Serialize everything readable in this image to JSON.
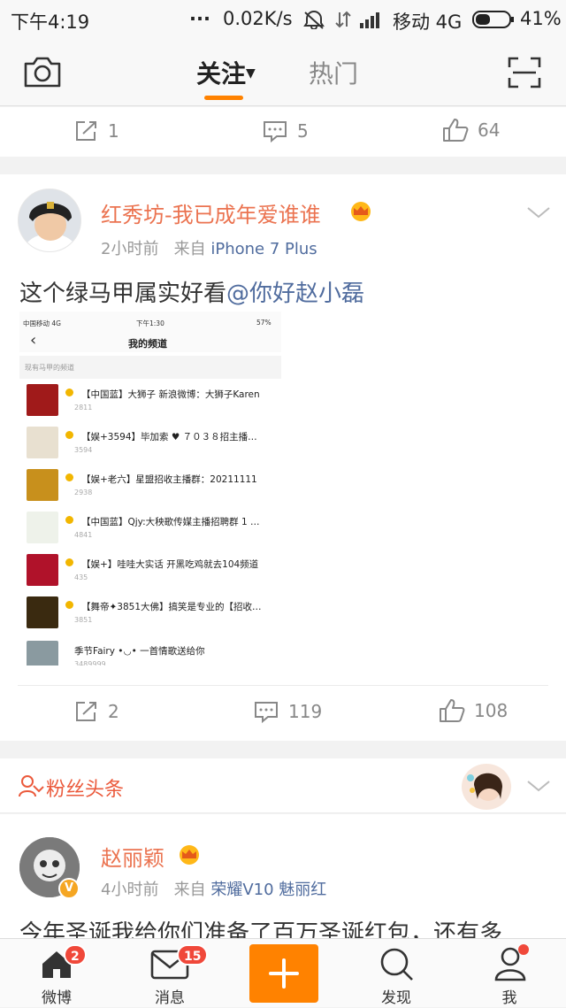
{
  "status_bar": {
    "time": "下午4:19",
    "dots": "...",
    "net_speed": "0.02K/s",
    "carrier": "移动 4G",
    "battery": "41%"
  },
  "top_nav": {
    "tabs": [
      {
        "label": "关注",
        "active": true
      },
      {
        "label": "热门",
        "active": false
      }
    ]
  },
  "post_prev": {
    "actions": {
      "repost": "1",
      "comment": "5",
      "like": "64"
    }
  },
  "post1": {
    "author": "红秀坊-我已成年爱谁谁",
    "time": "2小时前",
    "from_label": "来自",
    "source": "iPhone 7 Plus",
    "text": "这个绿马甲属实好看",
    "mention": "@你好赵小磊",
    "embedded": {
      "status_carrier": "中国移动  4G",
      "status_time": "下午1:30",
      "status_battery": "57%",
      "back": "‹",
      "title": "我的频道",
      "section_label": "现有马甲的频道",
      "channels": [
        {
          "title": "【中国蓝】大狮子 新浪微博：大狮子Karen",
          "count": "2811"
        },
        {
          "title": "【娱+3594】毕加索 ♥ ７０３８招主播…",
          "count": "3594"
        },
        {
          "title": "【娱+老六】星盟招收主播群：20211111",
          "count": "2938"
        },
        {
          "title": "【中国蓝】Qjy:大秧歌传媒主播招聘群 1 …",
          "count": "4841"
        },
        {
          "title": "【娱+】哇哇大实话  开黑吃鸡就去104频道",
          "count": "435"
        },
        {
          "title": "【舞帝✦3851大佛】搞笑是专业的【招收…",
          "count": "3851"
        },
        {
          "title": "季节Fairy •◡• 一首情歌送给你",
          "count": "3489999"
        }
      ]
    },
    "actions": {
      "repost": "2",
      "comment": "119",
      "like": "108"
    }
  },
  "fan_headline": {
    "label": "粉丝头条"
  },
  "post2": {
    "author": "赵丽颖",
    "time": "4小时前",
    "from_label": "来自",
    "source": "荣耀V10 魅丽红",
    "text": "今年圣诞我给你们准备了百万圣诞红包，还有多"
  },
  "bottom_bar": {
    "items": [
      {
        "label": "微博",
        "badge": "2"
      },
      {
        "label": "消息",
        "badge": "15"
      },
      {
        "label": "",
        "badge": ""
      },
      {
        "label": "发现",
        "badge": ""
      },
      {
        "label": "我",
        "badge": ""
      }
    ]
  },
  "colors": {
    "accent_orange": "#ff8200",
    "name_orange": "#eb7350",
    "link_blue": "#506c9e",
    "badge_red": "#f0483a"
  }
}
